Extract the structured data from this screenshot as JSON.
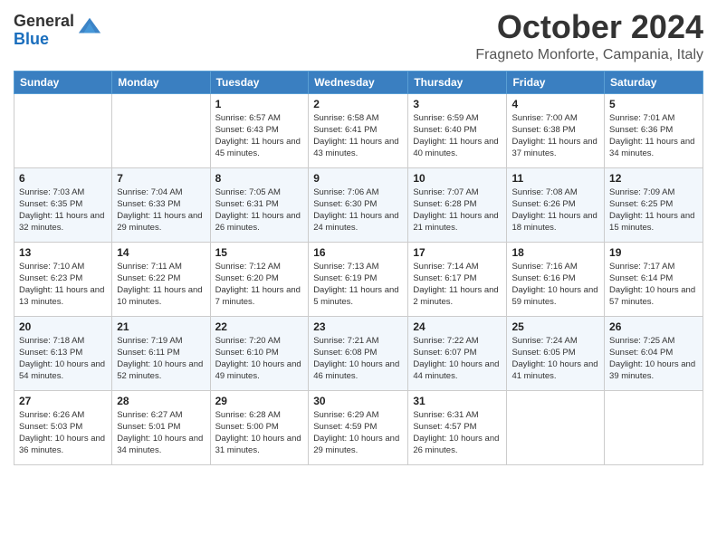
{
  "header": {
    "logo_general": "General",
    "logo_blue": "Blue",
    "month_title": "October 2024",
    "location": "Fragneto Monforte, Campania, Italy"
  },
  "days_of_week": [
    "Sunday",
    "Monday",
    "Tuesday",
    "Wednesday",
    "Thursday",
    "Friday",
    "Saturday"
  ],
  "weeks": [
    [
      {
        "day": "",
        "sunrise": "",
        "sunset": "",
        "daylight": ""
      },
      {
        "day": "",
        "sunrise": "",
        "sunset": "",
        "daylight": ""
      },
      {
        "day": "1",
        "sunrise": "Sunrise: 6:57 AM",
        "sunset": "Sunset: 6:43 PM",
        "daylight": "Daylight: 11 hours and 45 minutes."
      },
      {
        "day": "2",
        "sunrise": "Sunrise: 6:58 AM",
        "sunset": "Sunset: 6:41 PM",
        "daylight": "Daylight: 11 hours and 43 minutes."
      },
      {
        "day": "3",
        "sunrise": "Sunrise: 6:59 AM",
        "sunset": "Sunset: 6:40 PM",
        "daylight": "Daylight: 11 hours and 40 minutes."
      },
      {
        "day": "4",
        "sunrise": "Sunrise: 7:00 AM",
        "sunset": "Sunset: 6:38 PM",
        "daylight": "Daylight: 11 hours and 37 minutes."
      },
      {
        "day": "5",
        "sunrise": "Sunrise: 7:01 AM",
        "sunset": "Sunset: 6:36 PM",
        "daylight": "Daylight: 11 hours and 34 minutes."
      }
    ],
    [
      {
        "day": "6",
        "sunrise": "Sunrise: 7:03 AM",
        "sunset": "Sunset: 6:35 PM",
        "daylight": "Daylight: 11 hours and 32 minutes."
      },
      {
        "day": "7",
        "sunrise": "Sunrise: 7:04 AM",
        "sunset": "Sunset: 6:33 PM",
        "daylight": "Daylight: 11 hours and 29 minutes."
      },
      {
        "day": "8",
        "sunrise": "Sunrise: 7:05 AM",
        "sunset": "Sunset: 6:31 PM",
        "daylight": "Daylight: 11 hours and 26 minutes."
      },
      {
        "day": "9",
        "sunrise": "Sunrise: 7:06 AM",
        "sunset": "Sunset: 6:30 PM",
        "daylight": "Daylight: 11 hours and 24 minutes."
      },
      {
        "day": "10",
        "sunrise": "Sunrise: 7:07 AM",
        "sunset": "Sunset: 6:28 PM",
        "daylight": "Daylight: 11 hours and 21 minutes."
      },
      {
        "day": "11",
        "sunrise": "Sunrise: 7:08 AM",
        "sunset": "Sunset: 6:26 PM",
        "daylight": "Daylight: 11 hours and 18 minutes."
      },
      {
        "day": "12",
        "sunrise": "Sunrise: 7:09 AM",
        "sunset": "Sunset: 6:25 PM",
        "daylight": "Daylight: 11 hours and 15 minutes."
      }
    ],
    [
      {
        "day": "13",
        "sunrise": "Sunrise: 7:10 AM",
        "sunset": "Sunset: 6:23 PM",
        "daylight": "Daylight: 11 hours and 13 minutes."
      },
      {
        "day": "14",
        "sunrise": "Sunrise: 7:11 AM",
        "sunset": "Sunset: 6:22 PM",
        "daylight": "Daylight: 11 hours and 10 minutes."
      },
      {
        "day": "15",
        "sunrise": "Sunrise: 7:12 AM",
        "sunset": "Sunset: 6:20 PM",
        "daylight": "Daylight: 11 hours and 7 minutes."
      },
      {
        "day": "16",
        "sunrise": "Sunrise: 7:13 AM",
        "sunset": "Sunset: 6:19 PM",
        "daylight": "Daylight: 11 hours and 5 minutes."
      },
      {
        "day": "17",
        "sunrise": "Sunrise: 7:14 AM",
        "sunset": "Sunset: 6:17 PM",
        "daylight": "Daylight: 11 hours and 2 minutes."
      },
      {
        "day": "18",
        "sunrise": "Sunrise: 7:16 AM",
        "sunset": "Sunset: 6:16 PM",
        "daylight": "Daylight: 10 hours and 59 minutes."
      },
      {
        "day": "19",
        "sunrise": "Sunrise: 7:17 AM",
        "sunset": "Sunset: 6:14 PM",
        "daylight": "Daylight: 10 hours and 57 minutes."
      }
    ],
    [
      {
        "day": "20",
        "sunrise": "Sunrise: 7:18 AM",
        "sunset": "Sunset: 6:13 PM",
        "daylight": "Daylight: 10 hours and 54 minutes."
      },
      {
        "day": "21",
        "sunrise": "Sunrise: 7:19 AM",
        "sunset": "Sunset: 6:11 PM",
        "daylight": "Daylight: 10 hours and 52 minutes."
      },
      {
        "day": "22",
        "sunrise": "Sunrise: 7:20 AM",
        "sunset": "Sunset: 6:10 PM",
        "daylight": "Daylight: 10 hours and 49 minutes."
      },
      {
        "day": "23",
        "sunrise": "Sunrise: 7:21 AM",
        "sunset": "Sunset: 6:08 PM",
        "daylight": "Daylight: 10 hours and 46 minutes."
      },
      {
        "day": "24",
        "sunrise": "Sunrise: 7:22 AM",
        "sunset": "Sunset: 6:07 PM",
        "daylight": "Daylight: 10 hours and 44 minutes."
      },
      {
        "day": "25",
        "sunrise": "Sunrise: 7:24 AM",
        "sunset": "Sunset: 6:05 PM",
        "daylight": "Daylight: 10 hours and 41 minutes."
      },
      {
        "day": "26",
        "sunrise": "Sunrise: 7:25 AM",
        "sunset": "Sunset: 6:04 PM",
        "daylight": "Daylight: 10 hours and 39 minutes."
      }
    ],
    [
      {
        "day": "27",
        "sunrise": "Sunrise: 6:26 AM",
        "sunset": "Sunset: 5:03 PM",
        "daylight": "Daylight: 10 hours and 36 minutes."
      },
      {
        "day": "28",
        "sunrise": "Sunrise: 6:27 AM",
        "sunset": "Sunset: 5:01 PM",
        "daylight": "Daylight: 10 hours and 34 minutes."
      },
      {
        "day": "29",
        "sunrise": "Sunrise: 6:28 AM",
        "sunset": "Sunset: 5:00 PM",
        "daylight": "Daylight: 10 hours and 31 minutes."
      },
      {
        "day": "30",
        "sunrise": "Sunrise: 6:29 AM",
        "sunset": "Sunset: 4:59 PM",
        "daylight": "Daylight: 10 hours and 29 minutes."
      },
      {
        "day": "31",
        "sunrise": "Sunrise: 6:31 AM",
        "sunset": "Sunset: 4:57 PM",
        "daylight": "Daylight: 10 hours and 26 minutes."
      },
      {
        "day": "",
        "sunrise": "",
        "sunset": "",
        "daylight": ""
      },
      {
        "day": "",
        "sunrise": "",
        "sunset": "",
        "daylight": ""
      }
    ]
  ]
}
